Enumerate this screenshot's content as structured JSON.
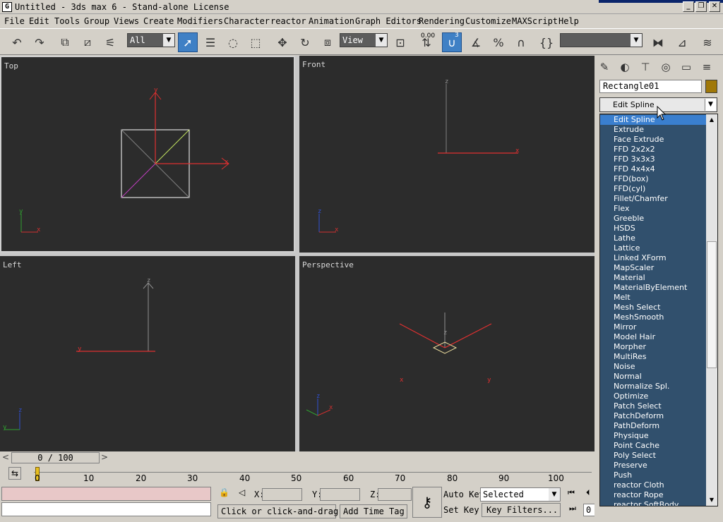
{
  "window": {
    "title": "Untitled - 3ds max 6 - Stand-alone License",
    "app_icon": "G",
    "minimize": "_",
    "maximize": "❐",
    "close": "✕"
  },
  "menu": [
    "File",
    "Edit",
    "Tools",
    "Group",
    "Views",
    "Create",
    "Modifiers",
    "Character",
    "reactor",
    "Animation",
    "Graph Editors",
    "Rendering",
    "Customize",
    "MAXScript",
    "Help"
  ],
  "toolbar": {
    "selection_filter": "All",
    "reference_coord": "View",
    "spinner_snap_value": "0.00",
    "snap_label": "3",
    "named_selection": "",
    "icons": [
      "undo-icon",
      "redo-icon",
      "select-and-link-icon",
      "unlink-icon",
      "bind-to-space-warp-icon",
      "select-object-icon",
      "select-by-name-icon",
      "selection-region-icon",
      "window-crossing-icon",
      "select-and-move-icon",
      "select-and-rotate-icon",
      "select-and-scale-icon",
      "use-pivot-center-icon",
      "spinner-snap-icon",
      "snap-toggle-icon",
      "angle-snap-icon",
      "percent-snap-icon",
      "spinner-snap-toggle-icon",
      "edit-named-selections-icon",
      "mirror-icon",
      "align-icon",
      "layer-manager-icon"
    ]
  },
  "viewports": [
    {
      "label": "Top"
    },
    {
      "label": "Front"
    },
    {
      "label": "Left"
    },
    {
      "label": "Perspective"
    }
  ],
  "axis_labels": {
    "x": "x",
    "y": "y",
    "z": "z"
  },
  "time_slider": {
    "value": "0 / 100",
    "prev": "<",
    "next": ">"
  },
  "track_bar": {
    "ticks": [
      "0",
      "10",
      "20",
      "30",
      "40",
      "50",
      "60",
      "70",
      "80",
      "90",
      "100"
    ]
  },
  "status": {
    "x_label": "X:",
    "y_label": "Y:",
    "z_label": "Z:",
    "prompt": "Click or click-and-drag",
    "add_time_tag": "Add Time Tag",
    "auto_key": "Auto Key",
    "set_key": "Set Key",
    "key_mode": "Selected",
    "key_filters": "Key Filters...",
    "frame": "0"
  },
  "command_panel": {
    "tabs": [
      "create-tab-icon",
      "modify-tab-icon",
      "hierarchy-tab-icon",
      "motion-tab-icon",
      "display-tab-icon",
      "utilities-tab-icon"
    ],
    "object_name": "Rectangle01",
    "object_color": "#a07808",
    "modifier_list_value": "Edit Spline"
  },
  "modifier_list": {
    "items": [
      "Edit Spline",
      "Extrude",
      "Face Extrude",
      "FFD 2x2x2",
      "FFD 3x3x3",
      "FFD 4x4x4",
      "FFD(box)",
      "FFD(cyl)",
      "Fillet/Chamfer",
      "Flex",
      "Greeble",
      "HSDS",
      "Lathe",
      "Lattice",
      "Linked XForm",
      "MapScaler",
      "Material",
      "MaterialByElement",
      "Melt",
      "Mesh Select",
      "MeshSmooth",
      "Mirror",
      "Model Hair",
      "Morpher",
      "MultiRes",
      "Noise",
      "Normal",
      "Normalize Spl.",
      "Optimize",
      "Patch Select",
      "PatchDeform",
      "PathDeform",
      "Physique",
      "Point Cache",
      "Poly Select",
      "Preserve",
      "Push",
      "reactor Cloth",
      "reactor Rope",
      "reactor SoftBody"
    ],
    "selected_index": 0
  }
}
